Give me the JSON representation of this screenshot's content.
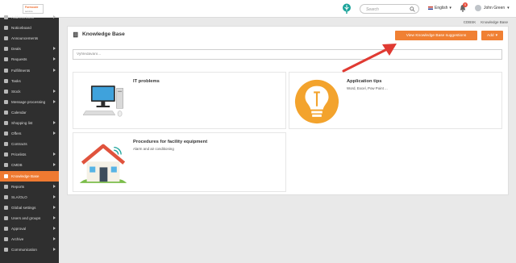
{
  "logo": {
    "line1": "Formcode",
    "line2": "service"
  },
  "topbar": {
    "search_placeholder": "Search",
    "language": "English",
    "notification_count": "5",
    "user_name": "John Green"
  },
  "sidebar": {
    "items": [
      {
        "label": "Address book",
        "arrow": true,
        "active": false
      },
      {
        "label": "Noticeboard",
        "arrow": false,
        "active": false
      },
      {
        "label": "Announcements",
        "arrow": false,
        "active": false
      },
      {
        "label": "Deals",
        "arrow": true,
        "active": false
      },
      {
        "label": "Requests",
        "arrow": true,
        "active": false
      },
      {
        "label": "Fulfillments",
        "arrow": true,
        "active": false
      },
      {
        "label": "Tasks",
        "arrow": false,
        "active": false
      },
      {
        "label": "Stock",
        "arrow": true,
        "active": false
      },
      {
        "label": "Message processing",
        "arrow": true,
        "active": false
      },
      {
        "label": "Calendar",
        "arrow": false,
        "active": false
      },
      {
        "label": "Shopping list",
        "arrow": true,
        "active": false
      },
      {
        "label": "Offers",
        "arrow": true,
        "active": false
      },
      {
        "label": "Contracts",
        "arrow": false,
        "active": false
      },
      {
        "label": "Pricelists",
        "arrow": true,
        "active": false
      },
      {
        "label": "CMDB",
        "arrow": true,
        "active": false
      },
      {
        "label": "Knowledge Base",
        "arrow": false,
        "active": true
      },
      {
        "label": "Reports",
        "arrow": true,
        "active": false
      },
      {
        "label": "SLA/OLO",
        "arrow": true,
        "active": false
      },
      {
        "label": "Global settings",
        "arrow": true,
        "active": false
      },
      {
        "label": "Users and groups",
        "arrow": true,
        "active": false
      },
      {
        "label": "Approval",
        "arrow": true,
        "active": false
      },
      {
        "label": "Archive",
        "arrow": true,
        "active": false
      },
      {
        "label": "Communication",
        "arrow": true,
        "active": false
      }
    ]
  },
  "breadcrumb": {
    "items": [
      "CDBSK",
      "Knowledge Base"
    ]
  },
  "main": {
    "title": "Knowledge Base",
    "suggestions_button": "View Knowledge Base suggestions",
    "add_button": "Add",
    "search_placeholder": "Vyhledávání...",
    "cards": [
      {
        "title": "IT problems",
        "description": ""
      },
      {
        "title": "Application tips",
        "description": "Word, Excel, Pow Point ..."
      },
      {
        "title": "Procedures for facility equipment",
        "description": "Alarm and air conditioning"
      }
    ]
  },
  "colors": {
    "accent": "#f08033",
    "sidebar_bg": "#2f2f2f",
    "arrow": "#e03a32"
  }
}
